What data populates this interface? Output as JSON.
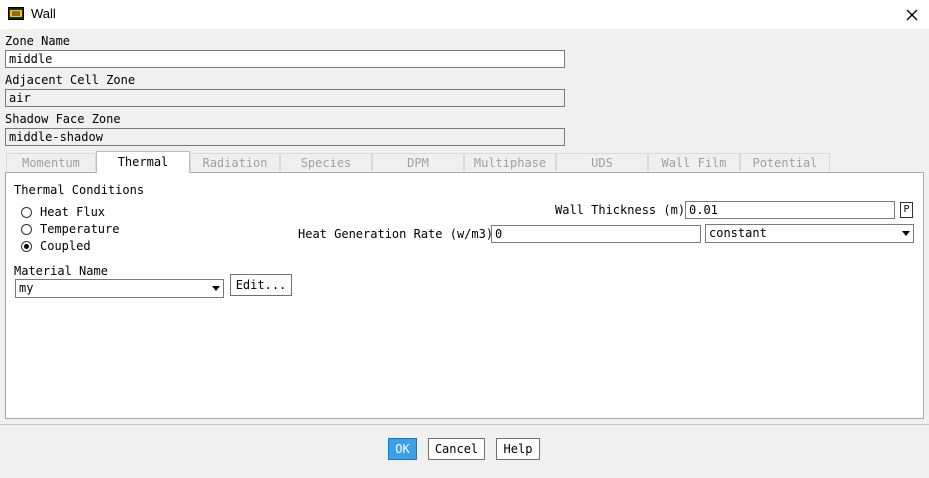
{
  "window": {
    "title": "Wall",
    "icon": "app-icon"
  },
  "zone_name": {
    "label": "Zone Name",
    "value": "middle"
  },
  "adjacent_cell_zone": {
    "label": "Adjacent Cell Zone",
    "value": "air"
  },
  "shadow_face_zone": {
    "label": "Shadow Face Zone",
    "value": "middle-shadow"
  },
  "tabs": [
    {
      "label": "Momentum",
      "active": false
    },
    {
      "label": "Thermal",
      "active": true
    },
    {
      "label": "Radiation",
      "active": false
    },
    {
      "label": "Species",
      "active": false
    },
    {
      "label": "DPM",
      "active": false
    },
    {
      "label": "Multiphase",
      "active": false
    },
    {
      "label": "UDS",
      "active": false
    },
    {
      "label": "Wall Film",
      "active": false
    },
    {
      "label": "Potential",
      "active": false
    }
  ],
  "thermal": {
    "group_title": "Thermal Conditions",
    "options": [
      {
        "label": "Heat Flux",
        "selected": false
      },
      {
        "label": "Temperature",
        "selected": false
      },
      {
        "label": "Coupled",
        "selected": true
      }
    ],
    "material_name_label": "Material Name",
    "material_name_value": "my",
    "edit_label": "Edit...",
    "wall_thickness_label": "Wall Thickness (m)",
    "wall_thickness_value": "0.01",
    "p_button_label": "P",
    "heat_gen_label": "Heat Generation Rate (w/m3)",
    "heat_gen_value": "0",
    "heat_gen_method": "constant"
  },
  "buttons": {
    "ok": "OK",
    "cancel": "Cancel",
    "help": "Help"
  }
}
